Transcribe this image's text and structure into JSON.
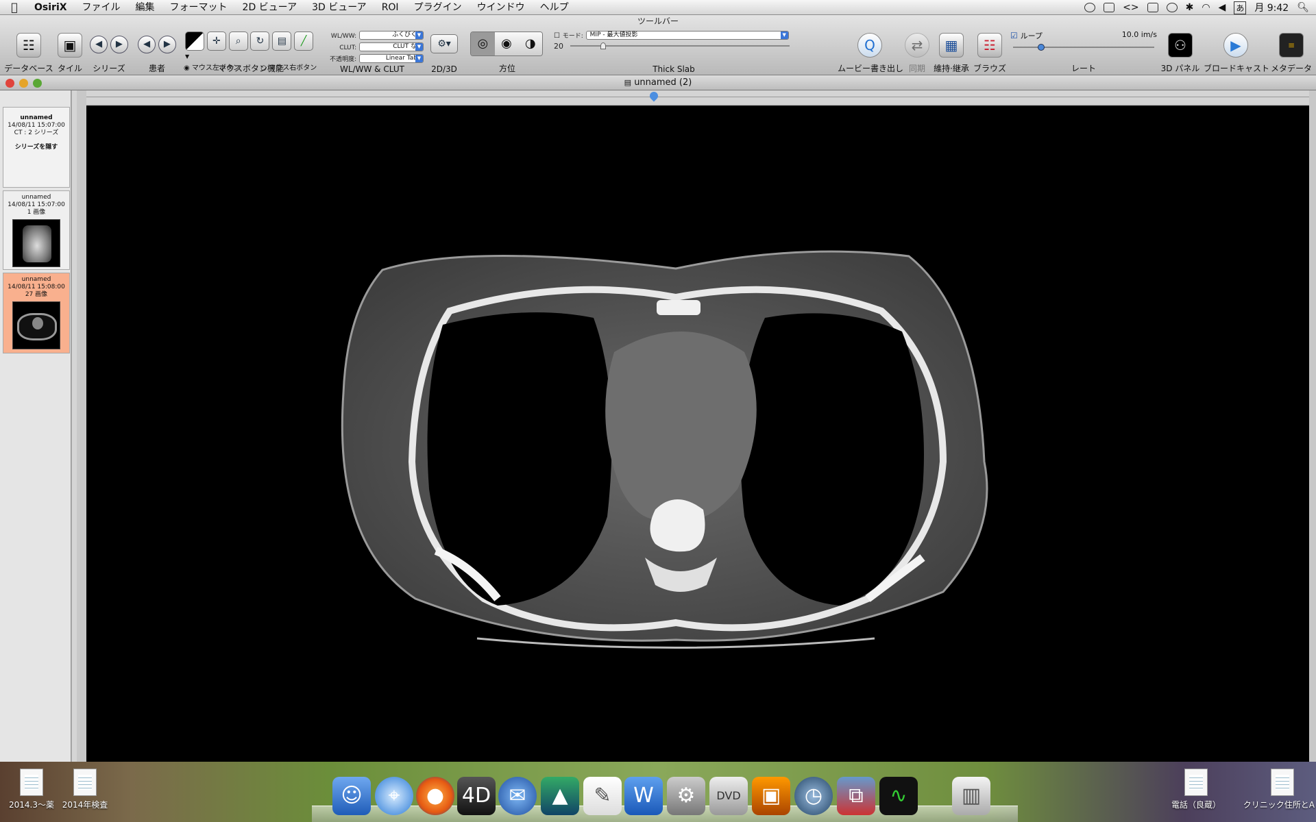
{
  "menubar": {
    "app": "OsiriX",
    "items": [
      "ファイル",
      "編集",
      "フォーマット",
      "2D ビューア",
      "3D ビューア",
      "ROI",
      "プラグイン",
      "ウインドウ",
      "ヘルプ"
    ],
    "input_mode": "あ",
    "clock": "月 9:42"
  },
  "toolbar": {
    "title": "ツールバー",
    "database": "データベース",
    "tile": "タイル",
    "series": "シリーズ",
    "patient": "患者",
    "mouse_function": "マウスボタン機能",
    "mouse_left": "マウス左ボタン",
    "mouse_right": "マウス右ボタン",
    "wlww_label": "WL/WW:",
    "wlww_value": "ふくびくう",
    "clut_label": "CLUT:",
    "clut_value": "CLUT なし",
    "opacity_label": "不透明度:",
    "opacity_value": "Linear Table",
    "wlww_clut": "WL/WW & CLUT",
    "twod_threed": "2D/3D",
    "orientation": "方位",
    "mode_label": "モード:",
    "mode_value": "MIP - 最大値投影",
    "slab_value": "20",
    "thick_slab": "Thick Slab",
    "movie_export": "ムービー書き出し",
    "sync": "同期",
    "keep_take": "維持·継承",
    "browse": "ブラウズ",
    "loop": "ループ",
    "rate_value": "10.0 im/s",
    "rate": "レート",
    "panel3d": "3D パネル",
    "broadcast": "ブロードキャスト",
    "metadata": "メタデータ"
  },
  "document": {
    "title": "unnamed (2)"
  },
  "sidebar": {
    "study": {
      "name": "unnamed",
      "date": "14/08/11 15:07:00",
      "info": "CT : 2 シリーズ",
      "hide": "シリーズを隠す"
    },
    "series": [
      {
        "name": "unnamed",
        "date": "14/08/11 15:07:00",
        "count": "1 画像"
      },
      {
        "name": "unnamed",
        "date": "14/08/11 15:08:00",
        "count": "27 画像"
      }
    ]
  },
  "desktop": {
    "left_icons": [
      "2014.3〜薬",
      "2014年検査"
    ],
    "right_icons": [
      "電話（良蔵）",
      "クリニック住所とA"
    ]
  },
  "dock": {
    "apps": [
      "Finder",
      "Safari",
      "Firefox",
      "4D",
      "Thunderbird",
      "Google Earth",
      "TextEdit",
      "Word",
      "System Preferences",
      "DVD Player",
      "iPhoto",
      "Time Machine",
      "VMware Fusion",
      "Activity Monitor",
      "Trash"
    ]
  },
  "colors": {
    "selected_series": "#f9b08e",
    "viewer_bg": "#000000"
  }
}
